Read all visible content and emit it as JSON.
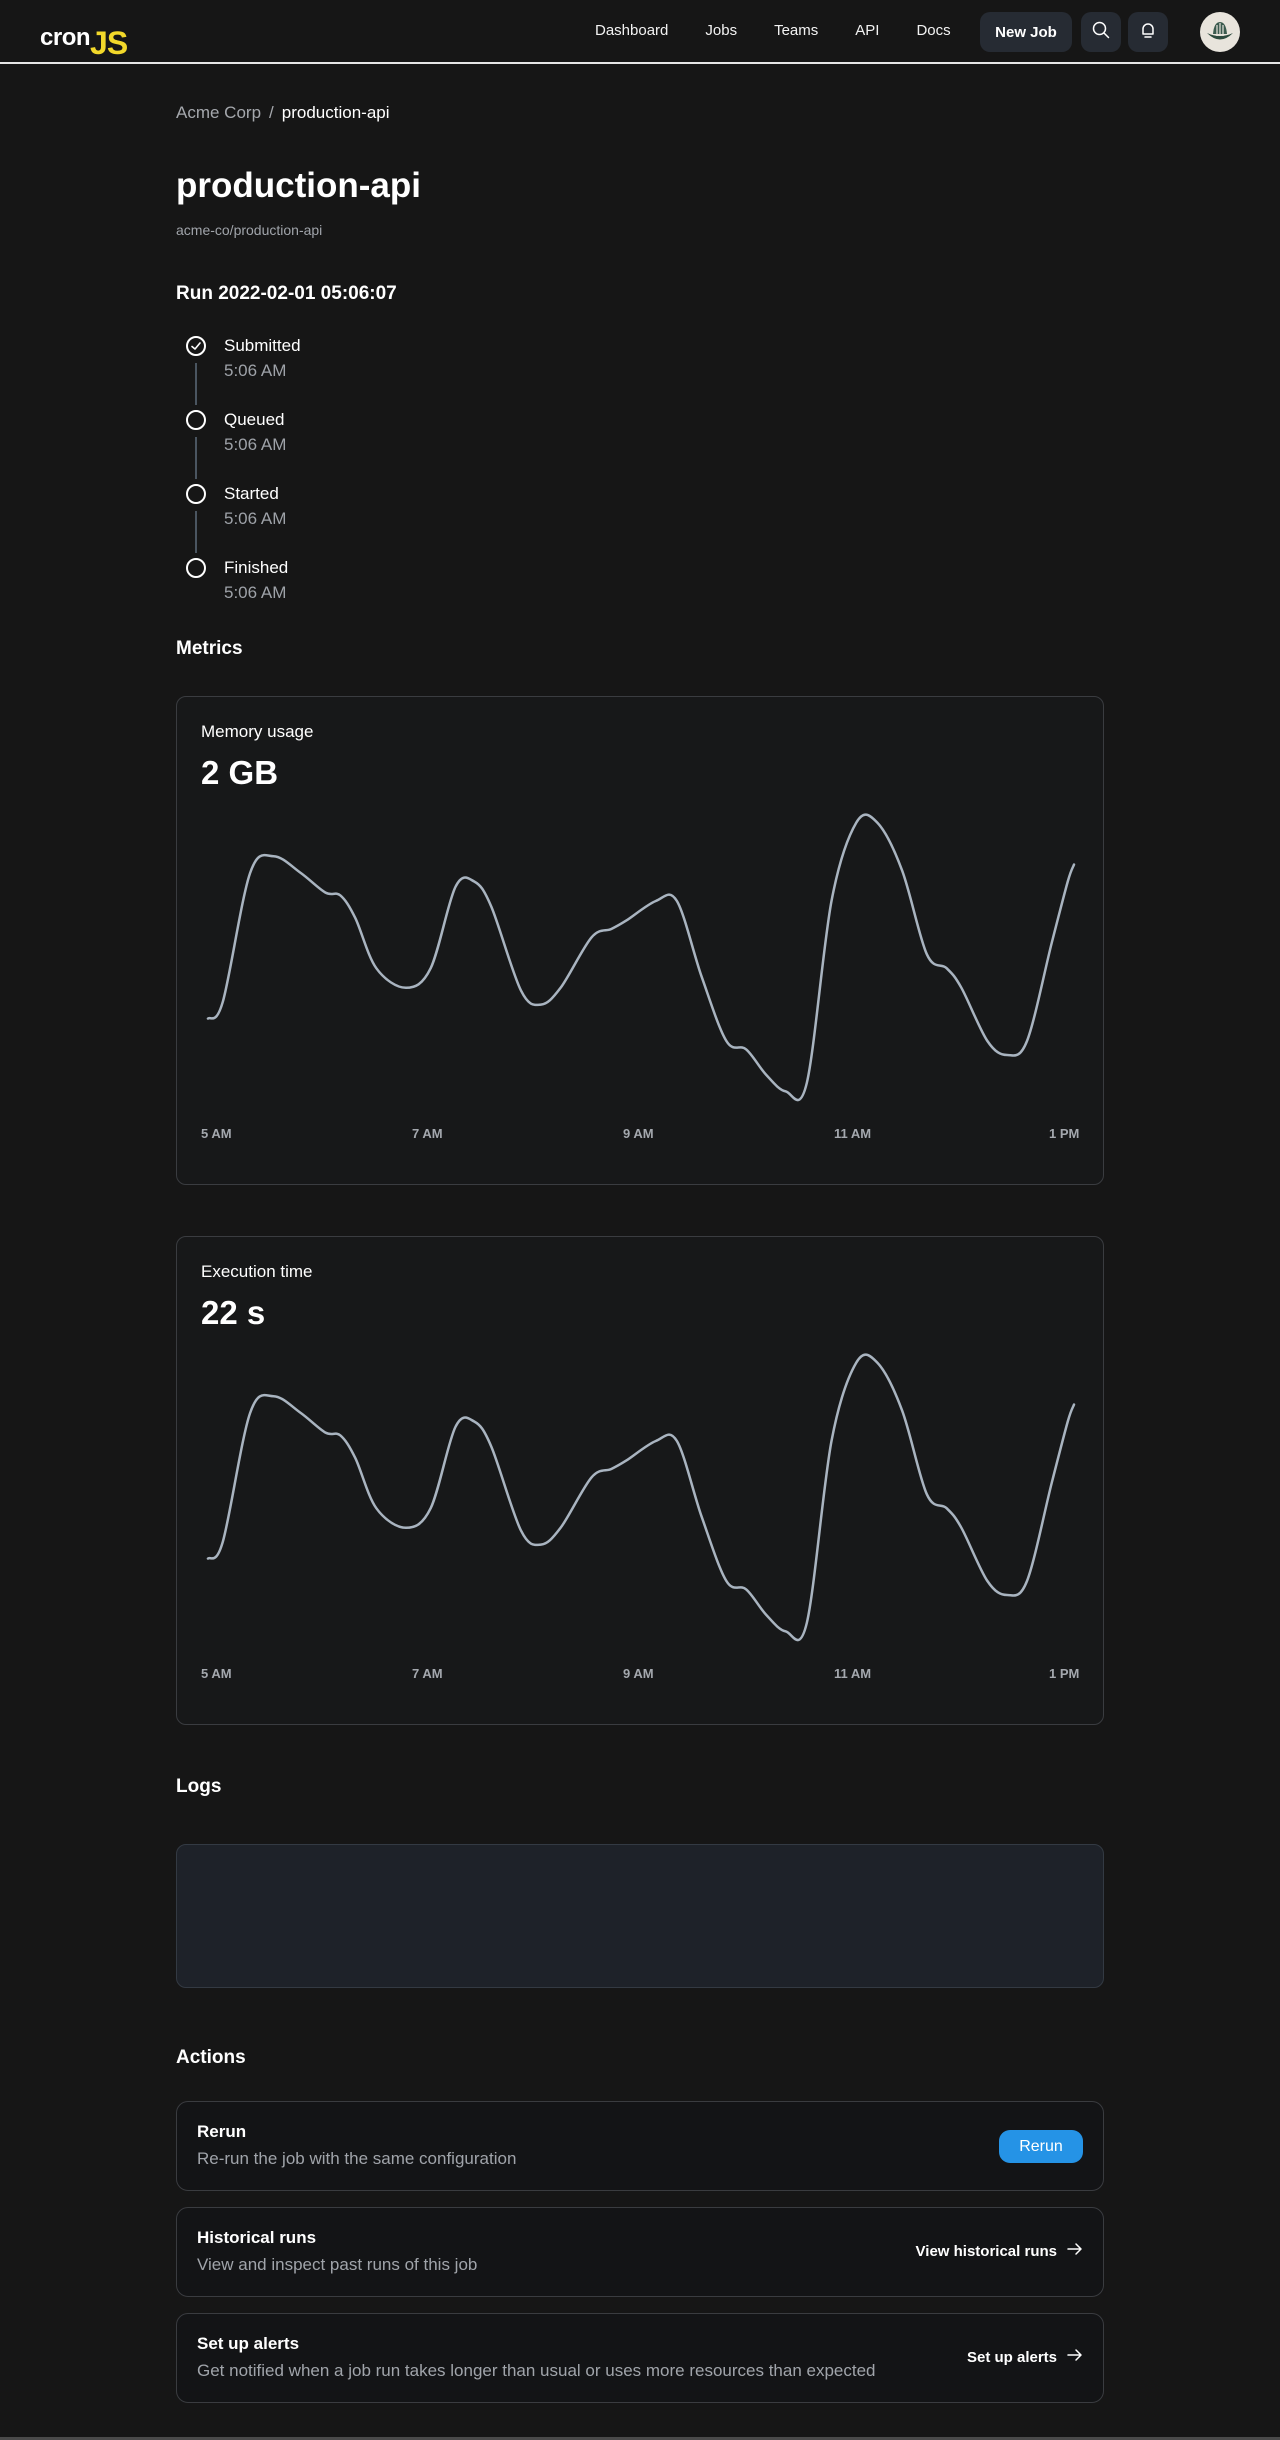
{
  "nav": {
    "logo_text_1": "cron",
    "logo_text_2": "JS",
    "links": [
      "Dashboard",
      "Jobs",
      "Teams",
      "API",
      "Docs"
    ],
    "new_job_label": "New Job",
    "search_icon": "search-icon",
    "bell_icon": "bell-icon",
    "avatar_icon": "avatar"
  },
  "breadcrumb": {
    "root": "Acme Corp",
    "separator": "/",
    "current": "production-api"
  },
  "page": {
    "title": "production-api",
    "subtitle": "acme-co/production-api",
    "run_title": "Run 2022-02-01 05:06:07"
  },
  "timeline": [
    {
      "label": "Submitted",
      "time": "5:06 AM",
      "done": true
    },
    {
      "label": "Queued",
      "time": "5:06 AM",
      "done": false
    },
    {
      "label": "Started",
      "time": "5:06 AM",
      "done": false
    },
    {
      "label": "Finished",
      "time": "5:06 AM",
      "done": false
    }
  ],
  "sections": {
    "metrics": "Metrics",
    "logs": "Logs",
    "actions": "Actions"
  },
  "colors": {
    "accent": "#2593e6",
    "logo_yellow": "#f2d82a",
    "line": "#a9b4c0"
  },
  "chart_data": [
    {
      "type": "line",
      "title": "Memory usage",
      "headline_value": "2 GB",
      "xlabel": "",
      "ylabel": "",
      "x_ticks": [
        "5 AM",
        "7 AM",
        "9 AM",
        "11 AM",
        "1 PM"
      ],
      "x_range": [
        5,
        13
      ],
      "ylim": [
        0,
        100
      ],
      "grid": false,
      "x": [
        5.0,
        5.12,
        5.34,
        5.53,
        5.75,
        5.95,
        6.07,
        6.19,
        6.36,
        6.6,
        6.8,
        7.0,
        7.15,
        7.29,
        7.53,
        7.69,
        7.85,
        8.1,
        8.26,
        8.38,
        8.62,
        8.79,
        8.99,
        9.19,
        9.35,
        9.51,
        9.67,
        9.84,
        10.04,
        10.24,
        10.41,
        10.61,
        10.81,
        10.97,
        11.09,
        11.3,
        11.46,
        11.62,
        11.82,
        11.95,
        12.0
      ],
      "values": [
        28,
        34,
        80,
        86,
        80,
        73,
        72,
        64,
        46,
        39,
        46,
        75,
        77,
        68,
        38,
        33,
        39,
        57,
        60,
        63,
        70,
        70,
        43,
        20,
        17,
        8,
        2,
        5,
        70,
        98,
        98,
        81,
        51,
        46,
        39,
        20,
        15,
        20,
        55,
        77,
        83
      ]
    },
    {
      "type": "line",
      "title": "Execution time",
      "headline_value": "22 s",
      "xlabel": "",
      "ylabel": "",
      "x_ticks": [
        "5 AM",
        "7 AM",
        "9 AM",
        "11 AM",
        "1 PM"
      ],
      "x_range": [
        5,
        13
      ],
      "ylim": [
        0,
        100
      ],
      "grid": false,
      "x": [
        5.0,
        5.12,
        5.34,
        5.53,
        5.75,
        5.95,
        6.07,
        6.19,
        6.36,
        6.6,
        6.8,
        7.0,
        7.15,
        7.29,
        7.53,
        7.69,
        7.85,
        8.1,
        8.26,
        8.38,
        8.62,
        8.79,
        8.99,
        9.19,
        9.35,
        9.51,
        9.67,
        9.84,
        10.04,
        10.24,
        10.41,
        10.61,
        10.81,
        10.97,
        11.09,
        11.3,
        11.46,
        11.62,
        11.82,
        11.95,
        12.0
      ],
      "values": [
        28,
        34,
        80,
        86,
        80,
        73,
        72,
        64,
        46,
        39,
        46,
        75,
        77,
        68,
        38,
        33,
        39,
        57,
        60,
        63,
        70,
        70,
        43,
        20,
        17,
        8,
        2,
        5,
        70,
        98,
        98,
        81,
        51,
        46,
        39,
        20,
        15,
        20,
        55,
        77,
        83
      ]
    }
  ],
  "actions": [
    {
      "title": "Rerun",
      "description": "Re-run the job with the same configuration",
      "button": "Rerun"
    },
    {
      "title": "Historical runs",
      "description": "View and inspect past runs of this job",
      "link": "View historical runs"
    },
    {
      "title": "Set up alerts",
      "description": "Get notified when a job run takes longer than usual or uses more resources than expected",
      "link": "Set up alerts"
    }
  ]
}
